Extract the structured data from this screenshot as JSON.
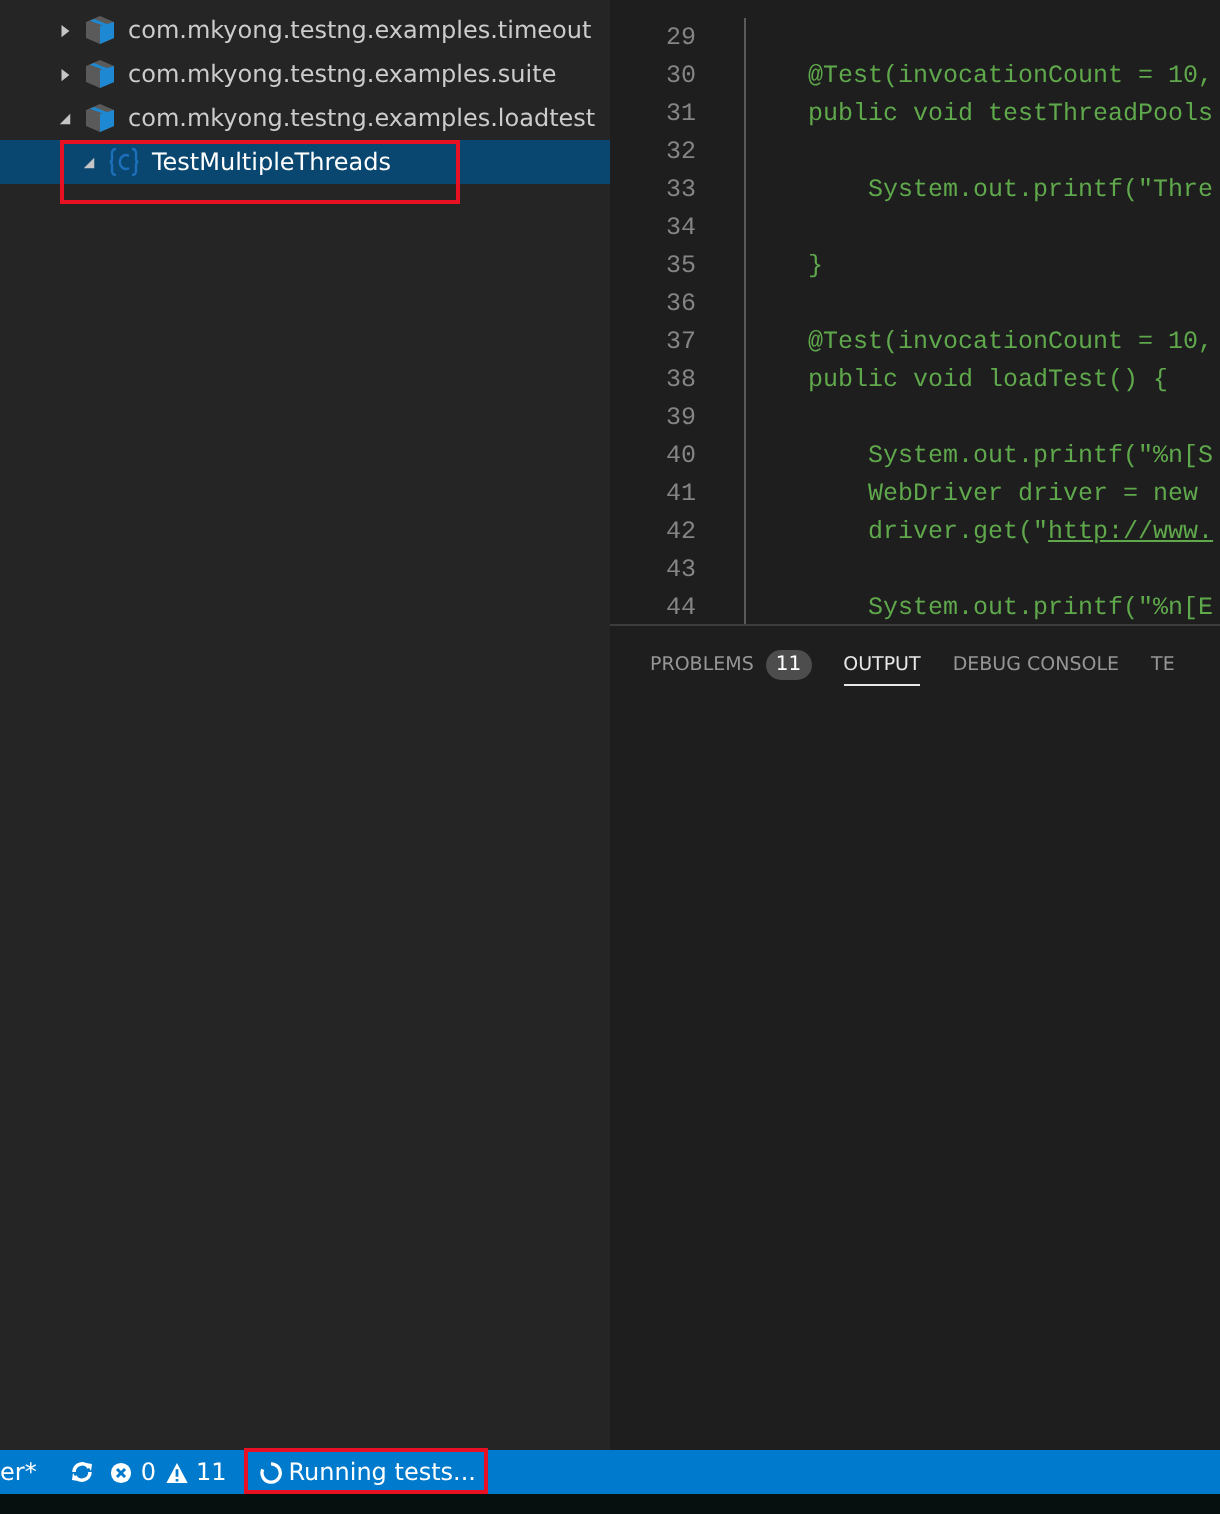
{
  "explorer": {
    "items": [
      {
        "label": "com.mkyong.testng.examples.timeout",
        "kind": "package",
        "expanded": false,
        "selected": false
      },
      {
        "label": "com.mkyong.testng.examples.suite",
        "kind": "package",
        "expanded": false,
        "selected": false
      },
      {
        "label": "com.mkyong.testng.examples.loadtest",
        "kind": "package",
        "expanded": true,
        "selected": false,
        "children": [
          {
            "label": "TestMultipleThreads",
            "kind": "class",
            "expanded": true,
            "selected": true,
            "highlighted": true
          }
        ]
      }
    ]
  },
  "editor": {
    "lines": [
      {
        "number": "29"
      },
      {
        "number": "30",
        "text": "@Test(invocationCount = 10,"
      },
      {
        "number": "31",
        "text": "public void testThreadPools"
      },
      {
        "number": "32"
      },
      {
        "number": "33",
        "text": "    System.out.printf(\"Thre"
      },
      {
        "number": "34"
      },
      {
        "number": "35",
        "text": "}"
      },
      {
        "number": "36"
      },
      {
        "number": "37",
        "text": "@Test(invocationCount = 10,"
      },
      {
        "number": "38",
        "text": "public void loadTest() {"
      },
      {
        "number": "39"
      },
      {
        "number": "40",
        "text": "    System.out.printf(\"%n[S"
      },
      {
        "number": "41",
        "text": "    WebDriver driver = new"
      },
      {
        "number": "42",
        "text": "    driver.get(\"",
        "link": "http://www."
      },
      {
        "number": "43"
      },
      {
        "number": "44",
        "text": "    System.out.printf(\"%n[E"
      }
    ]
  },
  "panel": {
    "tabs": [
      {
        "label": "PROBLEMS",
        "badge": "11",
        "selected": false
      },
      {
        "label": "OUTPUT",
        "selected": true
      },
      {
        "label": "DEBUG CONSOLE",
        "selected": false
      },
      {
        "label": "TE",
        "selected": false
      }
    ]
  },
  "status_bar": {
    "branch": "er*",
    "errors": "0",
    "warnings": "11",
    "task": {
      "label": "Running tests...",
      "highlighted": true
    }
  }
}
